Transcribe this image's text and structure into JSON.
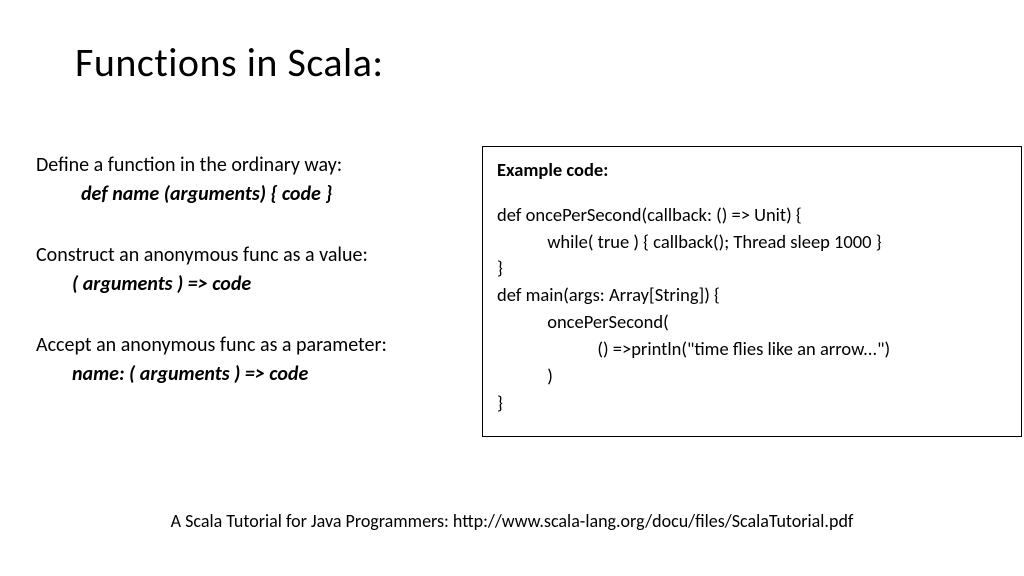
{
  "title": "Functions in Scala:",
  "left": {
    "define_desc": "Define a function in the ordinary way:",
    "define_syntax": "def name (arguments) { code }",
    "anon_val_desc": "Construct an anonymous func as a value:",
    "anon_val_syntax": "( arguments ) => code",
    "anon_param_desc": "Accept an anonymous func as a parameter:",
    "anon_param_syntax": "name: ( arguments ) => code"
  },
  "example": {
    "heading": "Example code:",
    "l1": "def oncePerSecond(callback: () => Unit) {",
    "l2": "            while( true ) { callback(); Thread sleep 1000 }",
    "l3": "}",
    "l4": "",
    "l5": "def main(args: Array[String]) {",
    "l6": "            oncePerSecond(",
    "l7": "                        () =>println(\"time flies like an arrow...\")",
    "l8": "            )",
    "l9": "}"
  },
  "footer": "A Scala Tutorial for Java Programmers: http://www.scala-lang.org/docu/files/ScalaTutorial.pdf"
}
